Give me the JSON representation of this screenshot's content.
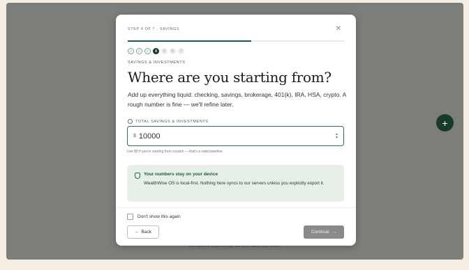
{
  "modal": {
    "step_text": "STEP 4 OF 7 · SAVINGS",
    "close_icon": "close-icon",
    "progress_fraction": 0.571,
    "steps": [
      {
        "label": "✓",
        "state": "done"
      },
      {
        "label": "✓",
        "state": "done"
      },
      {
        "label": "✓",
        "state": "done"
      },
      {
        "label": "4",
        "state": "current"
      },
      {
        "label": "5",
        "state": "todo"
      },
      {
        "label": "6",
        "state": "todo"
      },
      {
        "label": "7",
        "state": "todo"
      }
    ],
    "section_label": "SAVINGS & INVESTMENTS",
    "title": "Where are you starting from?",
    "description": "Add up everything liquid: checking, savings, brokerage, 401(k), IRA, HSA, crypto. A rough number is fine — we'll refine later.",
    "field": {
      "label": "TOTAL SAVINGS & INVESTMENTS",
      "currency": "$",
      "value": "10000",
      "hint": "Use $0 if you're starting from scratch — that's a valid baseline."
    },
    "callout": {
      "title": "Your numbers stay on your device",
      "body": "WealthWise OS is local-first. Nothing here syncs to our servers unless you explicitly export it."
    },
    "checkbox_label": "Don't show this again",
    "back_label": "Back",
    "continue_label": "Continue"
  },
  "footer_text": "Your data is encrypted locally and never leaves your device.",
  "colors": {
    "accent": "#1f5a3c",
    "accent_dark": "#163b29",
    "backdrop": "#7d7d7a",
    "callout_bg": "#e6efe8"
  }
}
